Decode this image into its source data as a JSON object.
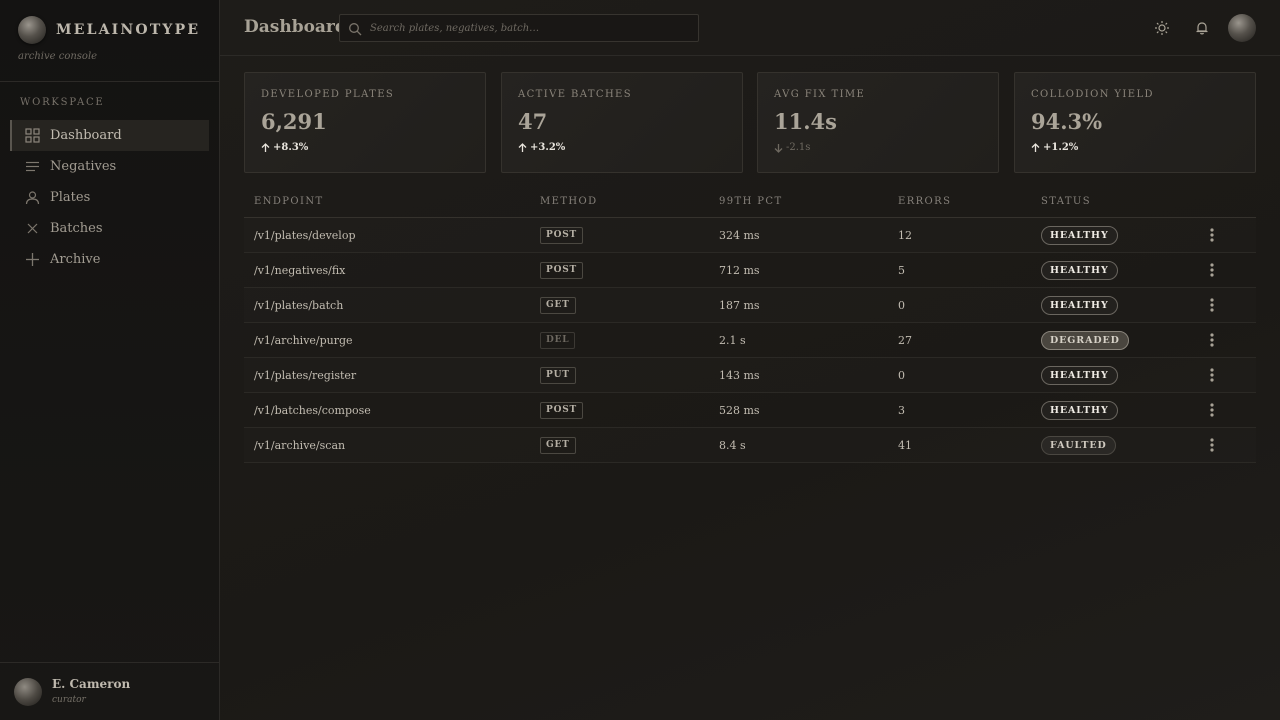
{
  "brand": {
    "name": "MELAINOTYPE",
    "subtitle": "archive console"
  },
  "sidebar": {
    "section": "WORKSPACE",
    "items": [
      {
        "label": "Dashboard",
        "icon": "grid-icon",
        "active": true
      },
      {
        "label": "Negatives",
        "icon": "list-icon"
      },
      {
        "label": "Plates",
        "icon": "user-icon"
      },
      {
        "label": "Batches",
        "icon": "close-x-icon"
      },
      {
        "label": "Archive",
        "icon": "plus-icon"
      }
    ]
  },
  "user": {
    "name": "E. Cameron",
    "role": "curator"
  },
  "header": {
    "title": "Dashboard",
    "search_placeholder": "Search plates, negatives, batch…"
  },
  "cards": [
    {
      "label": "DEVELOPED PLATES",
      "value": "6,291",
      "delta": "+8.3%",
      "trend": "up"
    },
    {
      "label": "ACTIVE BATCHES",
      "value": "47",
      "delta": "+3.2%",
      "trend": "up"
    },
    {
      "label": "AVG FIX TIME",
      "value": "11.4s",
      "delta": "-2.1s",
      "trend": "down"
    },
    {
      "label": "COLLODION YIELD",
      "value": "94.3%",
      "delta": "+1.2%",
      "trend": "up"
    }
  ],
  "table": {
    "headers": [
      "ENDPOINT",
      "METHOD",
      "99TH PCT",
      "ERRORS",
      "STATUS"
    ],
    "rows": [
      {
        "endpoint": "/v1/plates/develop",
        "method": "POST",
        "p99": "324 ms",
        "errors": "12",
        "status": "HEALTHY"
      },
      {
        "endpoint": "/v1/negatives/fix",
        "method": "POST",
        "p99": "712 ms",
        "errors": "5",
        "status": "HEALTHY"
      },
      {
        "endpoint": "/v1/plates/batch",
        "method": "GET",
        "p99": "187 ms",
        "errors": "0",
        "status": "HEALTHY"
      },
      {
        "endpoint": "/v1/archive/purge",
        "method": "DEL",
        "p99": "2.1 s",
        "errors": "27",
        "status": "DEGRADED"
      },
      {
        "endpoint": "/v1/plates/register",
        "method": "PUT",
        "p99": "143 ms",
        "errors": "0",
        "status": "HEALTHY"
      },
      {
        "endpoint": "/v1/batches/compose",
        "method": "POST",
        "p99": "528 ms",
        "errors": "3",
        "status": "HEALTHY"
      },
      {
        "endpoint": "/v1/archive/scan",
        "method": "GET",
        "p99": "8.4 s",
        "errors": "41",
        "status": "FAULTED"
      }
    ]
  }
}
